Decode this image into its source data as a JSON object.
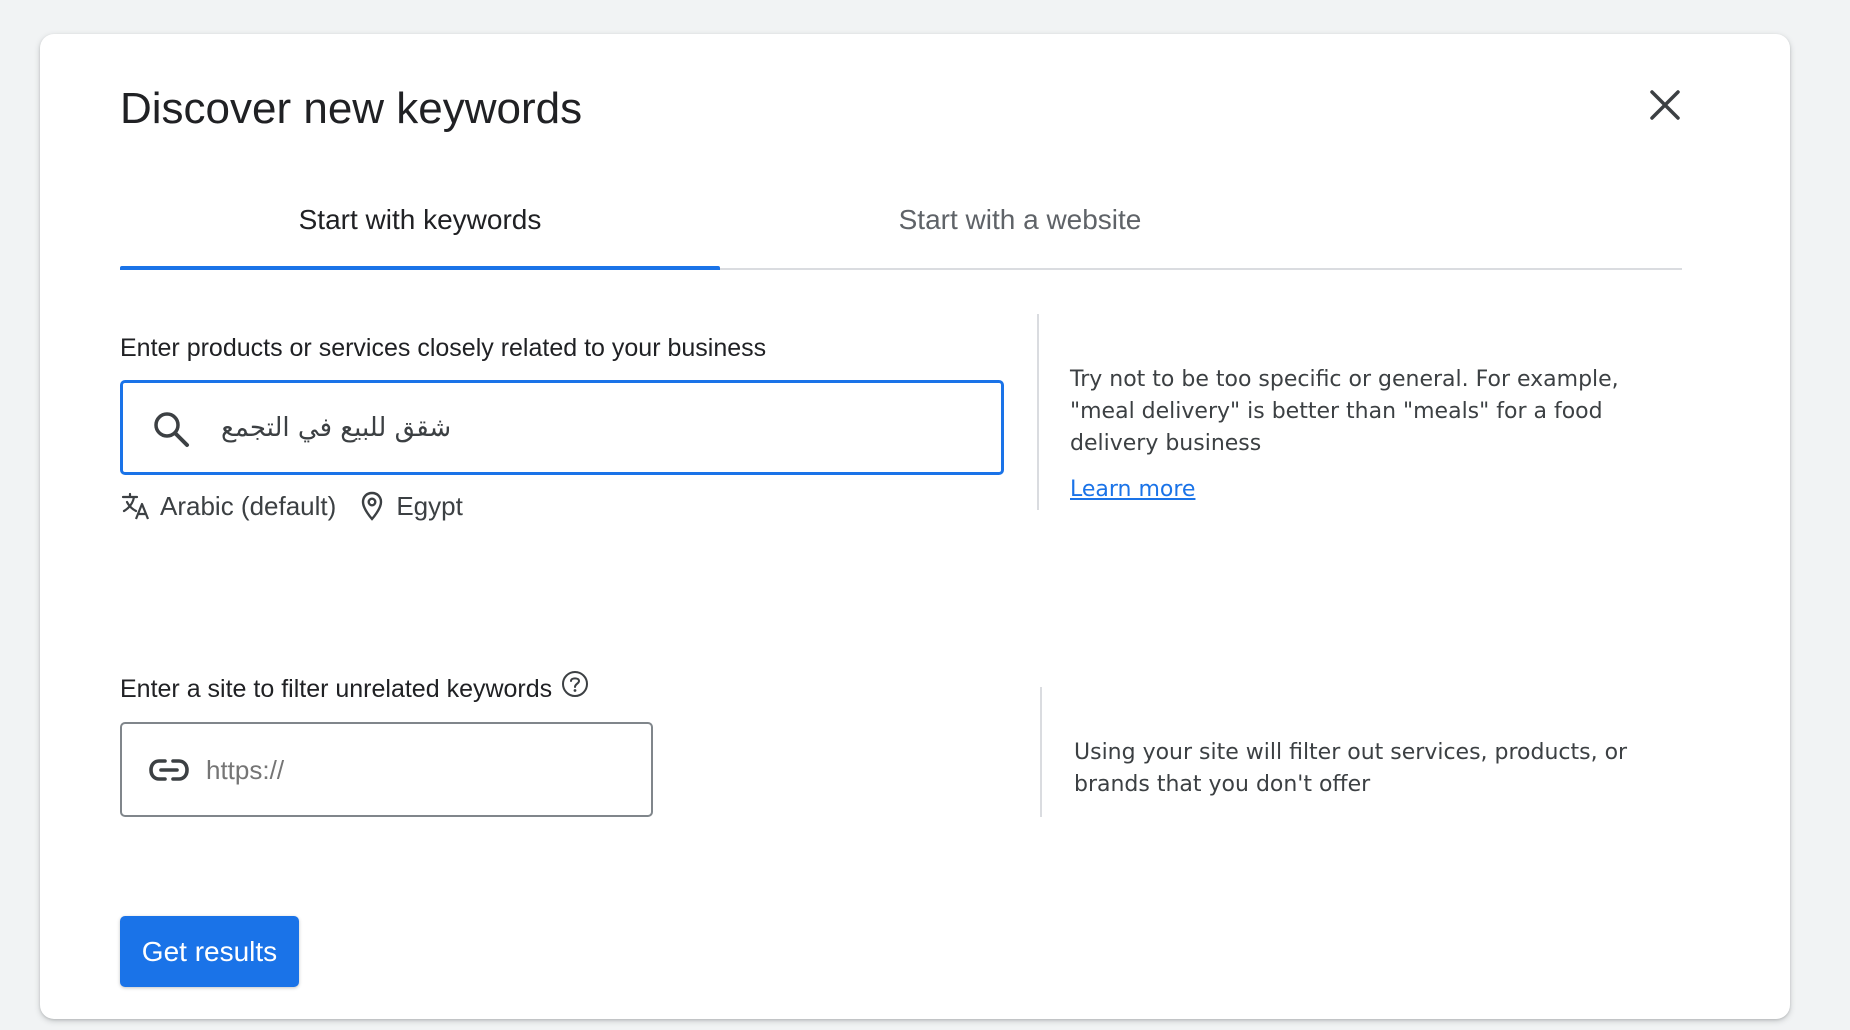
{
  "dialog": {
    "title": "Discover new keywords",
    "close_icon": "close-icon"
  },
  "tabs": [
    {
      "label": "Start with keywords",
      "active": true
    },
    {
      "label": "Start with a website",
      "active": false
    }
  ],
  "keywords_section": {
    "label": "Enter products or services closely related to your business",
    "search_icon": "search-icon",
    "input_value": "شقق للبيع في التجمع",
    "language_icon": "translate-icon",
    "language": "Arabic (default)",
    "location_icon": "location-pin-icon",
    "location": "Egypt",
    "help_text": "Try not to be too specific or general. For example, \"meal delivery\" is better than \"meals\" for a food delivery business",
    "learn_more": "Learn more"
  },
  "site_section": {
    "label": "Enter a site to filter unrelated keywords",
    "help_icon": "help-circle-icon",
    "link_icon": "link-icon",
    "placeholder": "https://",
    "help_text": "Using your site will filter out services, products, or brands that you don't offer"
  },
  "actions": {
    "get_results": "Get results"
  },
  "colors": {
    "accent": "#1a73e8",
    "text": "#202124",
    "secondary_text": "#5f6368",
    "divider": "#dadce0"
  }
}
